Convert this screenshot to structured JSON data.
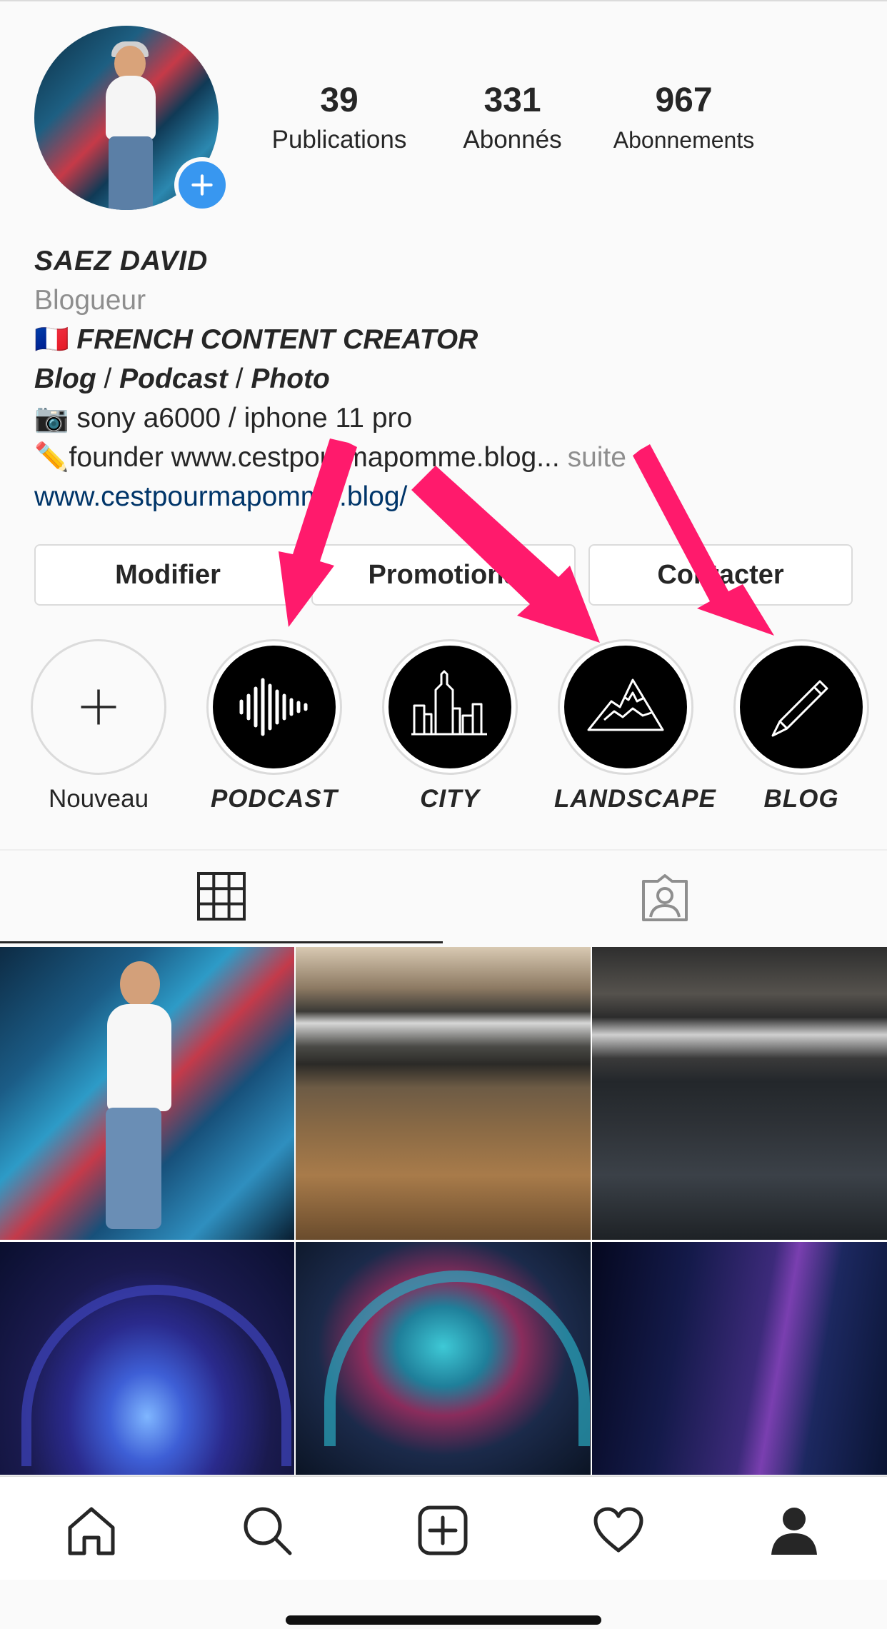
{
  "profile": {
    "stats": [
      {
        "value": "39",
        "label": "Publications"
      },
      {
        "value": "331",
        "label": "Abonnés"
      },
      {
        "value": "967",
        "label": "Abonnements"
      }
    ],
    "name": "SAEZ DAVID",
    "category": "Blogueur",
    "bio_line1_flag": "🇫🇷",
    "bio_line1": "FRENCH CONTENT CREATOR",
    "bio_line2_a": "Blog",
    "bio_line2_sep1": " / ",
    "bio_line2_b": "Podcast",
    "bio_line2_sep2": " / ",
    "bio_line2_c": "Photo",
    "bio_line3": "📷 sony a6000 / iphone 11 pro",
    "bio_line4": "✏️founder www.cestpourmapomme.blog...",
    "bio_more": " suite",
    "website": "www.cestpourmapomme.blog/"
  },
  "buttons": {
    "edit": "Modifier",
    "promotions": "Promotions",
    "contact": "Contacter"
  },
  "highlights": [
    {
      "label": "Nouveau",
      "icon": "plus-icon"
    },
    {
      "label": "PODCAST",
      "icon": "soundwave-icon"
    },
    {
      "label": "CITY",
      "icon": "skyline-icon"
    },
    {
      "label": "LANDSCAPE",
      "icon": "mountain-icon"
    },
    {
      "label": "BLOG",
      "icon": "pen-icon"
    }
  ],
  "tabs": [
    {
      "name": "grid",
      "icon": "grid-icon",
      "active": true
    },
    {
      "name": "tagged",
      "icon": "tagged-person-icon",
      "active": false
    }
  ],
  "posts": [
    {
      "subject": "man in front of graffiti wall"
    },
    {
      "subject": "mountain lake shore"
    },
    {
      "subject": "dark lake with snowy hills"
    },
    {
      "subject": "blue lit tunnel"
    },
    {
      "subject": "cyan arched tunnel"
    },
    {
      "subject": "purple lit corridor"
    }
  ],
  "bottom_nav": [
    {
      "name": "home",
      "icon": "home-icon"
    },
    {
      "name": "search",
      "icon": "search-icon"
    },
    {
      "name": "new-post",
      "icon": "add-post-icon"
    },
    {
      "name": "activity",
      "icon": "heart-icon"
    },
    {
      "name": "profile",
      "icon": "profile-icon"
    }
  ],
  "colors": {
    "accent_blue": "#3897f0",
    "link_blue": "#003569",
    "annotation_arrow": "#ff1a6c"
  }
}
